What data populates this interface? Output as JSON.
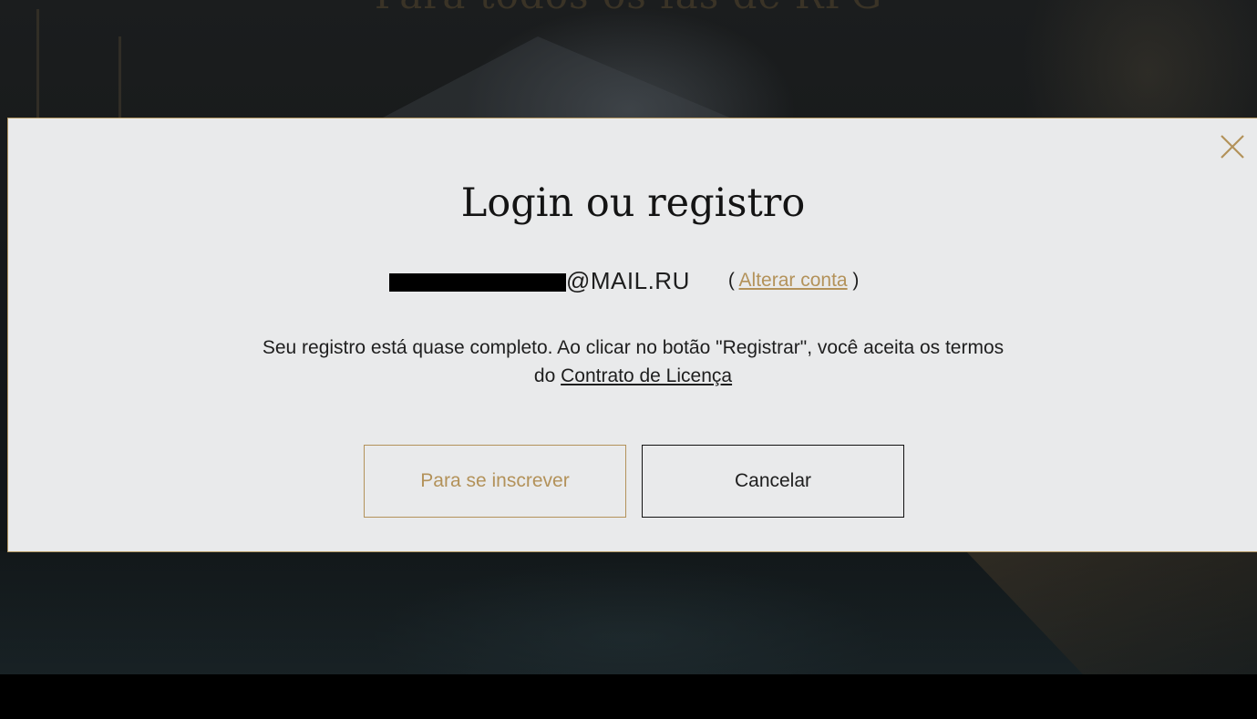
{
  "background": {
    "headline": "Para todos os fãs de RPG"
  },
  "modal": {
    "title": "Login ou registro",
    "close_icon": "close-icon",
    "account": {
      "email_domain": "@MAIL.RU",
      "change_prefix": "( ",
      "change_link": "Alterar conta",
      "change_suffix": " )"
    },
    "message_line1": "Seu registro está quase completo. Ao clicar no botão \"Registrar\", você aceita os termos",
    "message_line2_prefix": "do ",
    "license_link": "Contrato de Licença",
    "buttons": {
      "register": "Para se inscrever",
      "cancel": "Cancelar"
    }
  },
  "colors": {
    "accent_gold": "#b3925a",
    "modal_bg": "#e9eaeb",
    "text_dark": "#1e1e1e"
  }
}
